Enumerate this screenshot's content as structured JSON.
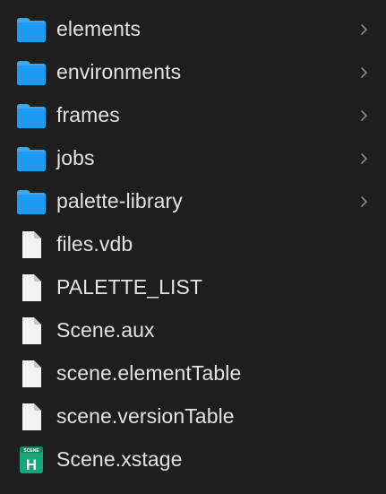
{
  "items": [
    {
      "name": "elements",
      "kind": "folder",
      "icon": "folder-icon"
    },
    {
      "name": "environments",
      "kind": "folder",
      "icon": "folder-icon"
    },
    {
      "name": "frames",
      "kind": "folder",
      "icon": "folder-icon"
    },
    {
      "name": "jobs",
      "kind": "folder",
      "icon": "folder-icon"
    },
    {
      "name": "palette-library",
      "kind": "folder",
      "icon": "folder-icon"
    },
    {
      "name": "files.vdb",
      "kind": "file",
      "icon": "document-icon"
    },
    {
      "name": "PALETTE_LIST",
      "kind": "file",
      "icon": "document-icon"
    },
    {
      "name": "Scene.aux",
      "kind": "file",
      "icon": "document-icon"
    },
    {
      "name": "scene.elementTable",
      "kind": "file",
      "icon": "document-icon"
    },
    {
      "name": "scene.versionTable",
      "kind": "file",
      "icon": "document-icon"
    },
    {
      "name": "Scene.xstage",
      "kind": "app-file",
      "icon": "scene-app-icon",
      "badge_top": "SCENE",
      "badge_letter": "H"
    }
  ],
  "colors": {
    "background": "#1e1e1e",
    "text": "#e3e3e3",
    "folder": "#1e9bf0",
    "folder_tab": "#3aa7f2",
    "chevron": "#8a8a8a",
    "scene_icon": "#17a57a"
  }
}
